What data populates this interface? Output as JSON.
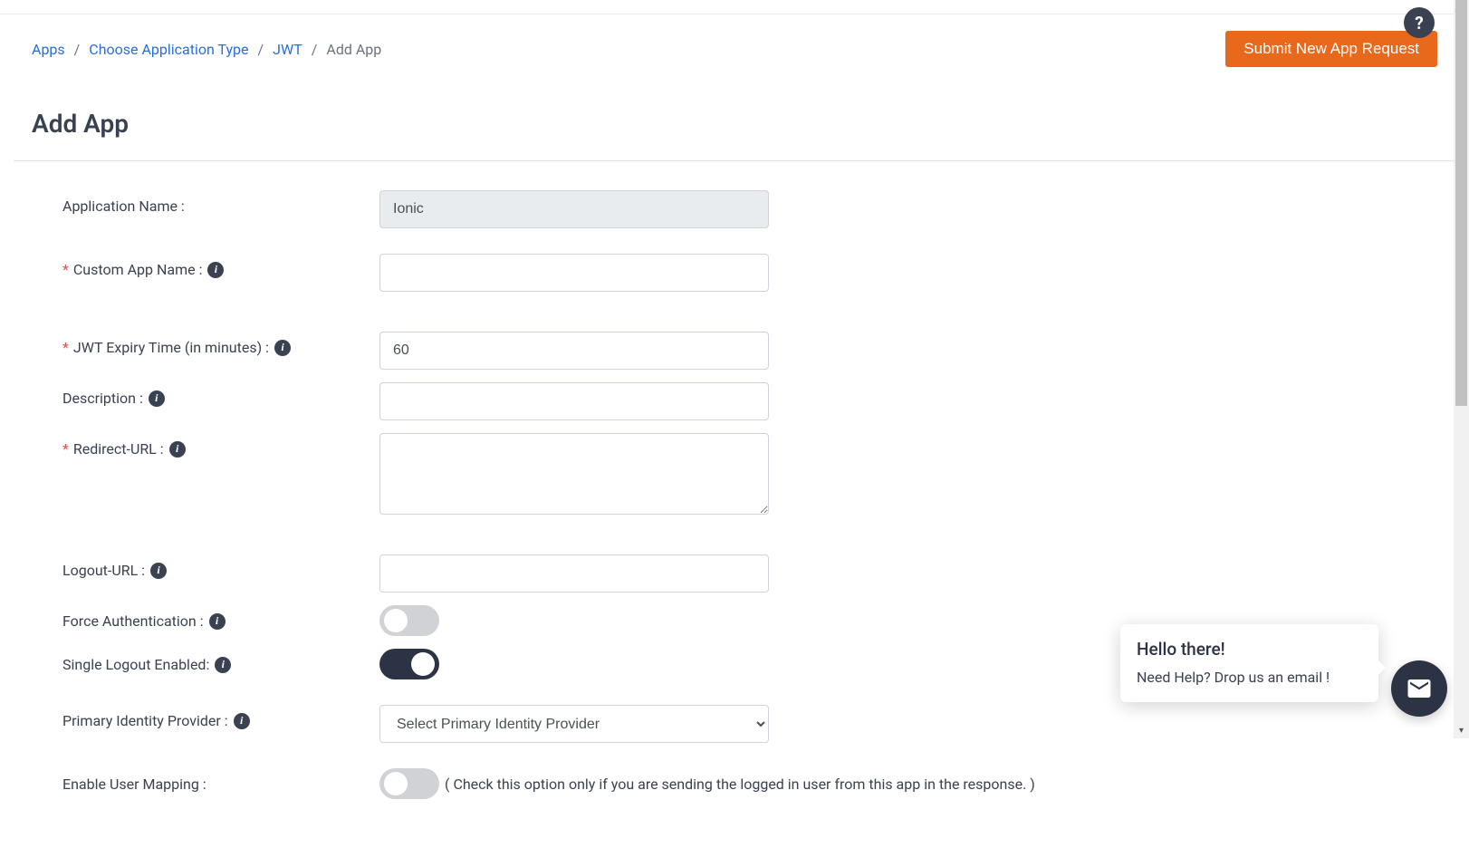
{
  "breadcrumb": {
    "items": [
      {
        "label": "Apps"
      },
      {
        "label": "Choose Application Type"
      },
      {
        "label": "JWT"
      }
    ],
    "current": "Add App"
  },
  "header": {
    "submit_label": "Submit New App Request",
    "help": "?"
  },
  "page_title": "Add App",
  "form": {
    "app_name": {
      "label": "Application Name :",
      "value": "Ionic"
    },
    "custom_app_name": {
      "label": "Custom App Name :",
      "value": ""
    },
    "jwt_expiry": {
      "label": "JWT Expiry Time (in minutes) :",
      "value": "60"
    },
    "description": {
      "label": "Description :",
      "value": ""
    },
    "redirect_url": {
      "label": "Redirect-URL :",
      "value": ""
    },
    "logout_url": {
      "label": "Logout-URL :",
      "value": ""
    },
    "force_auth": {
      "label": "Force Authentication :"
    },
    "slo": {
      "label": "Single Logout Enabled:"
    },
    "primary_idp": {
      "label": "Primary Identity Provider :",
      "selected": "Select Primary Identity Provider"
    },
    "user_mapping": {
      "label": "Enable User Mapping :",
      "hint": "( Check this option only if you are sending the logged in user from this app in the response. )"
    }
  },
  "chat": {
    "title": "Hello there!",
    "text": "Need Help? Drop us an email !"
  },
  "info_glyph": "i"
}
